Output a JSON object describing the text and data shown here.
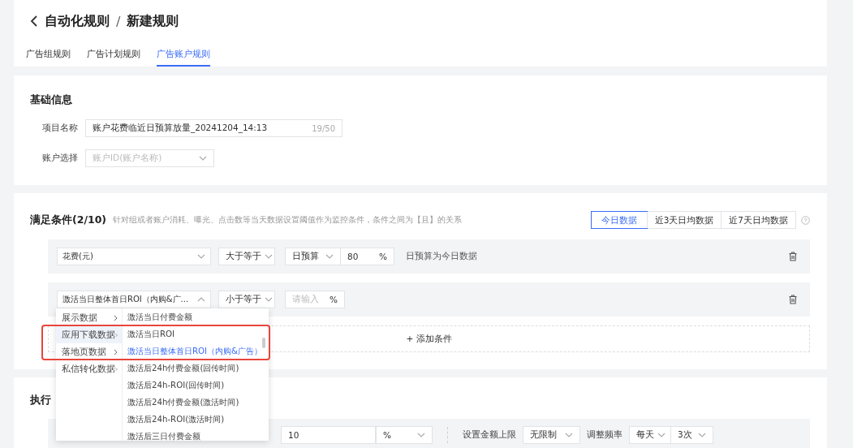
{
  "header": {
    "title": "自动化规则",
    "separator": "/",
    "subtitle": "新建规则"
  },
  "tabs": [
    {
      "label": "广告组规则",
      "selected": false
    },
    {
      "label": "广告计划规则",
      "selected": false
    },
    {
      "label": "广告账户规则",
      "selected": true
    }
  ],
  "basic_info": {
    "title": "基础信息",
    "fields": [
      {
        "kind": "text",
        "label": "项目名称",
        "value": "账户花费临近日预算放量_20241204_14:13",
        "counter": "19/50"
      },
      {
        "kind": "select",
        "label": "账户选择",
        "placeholder": "账户ID(账户名称)"
      }
    ]
  },
  "conditions": {
    "title": "满足条件(2/10)",
    "hint": "针对组或者账户消耗、曝光、点击数等当天数据设置阈值作为监控条件，条件之间为【且】的关系",
    "range_tabs": [
      {
        "label": "今日数据",
        "selected": true
      },
      {
        "label": "近3天日均数据",
        "selected": false
      },
      {
        "label": "近7天日均数据",
        "selected": false
      }
    ],
    "rows": [
      {
        "metric": "花费(元)",
        "metric_open": false,
        "operator": "大于等于",
        "base": "日预算",
        "value": "80",
        "unit": "%",
        "note": "日预算为今日数据"
      },
      {
        "metric": "激活当日整体首日ROI（内购&广...",
        "metric_open": true,
        "operator": "小于等于",
        "value_placeholder": "请输入",
        "unit": "%"
      }
    ],
    "add_label": "+ 添加条件"
  },
  "actions": {
    "title": "执行",
    "row": {
      "value": "10",
      "unit": "%",
      "cap_label": "设置金额上限",
      "cap": "无限制",
      "freq_label": "调整频率",
      "freq_period": "每天",
      "freq_count": "3次"
    }
  },
  "dropdown": {
    "highlighted": true,
    "categories": [
      {
        "label": "展示数据",
        "selected": false
      },
      {
        "label": "应用下载数据",
        "selected": true
      },
      {
        "label": "落地页数据",
        "selected": false
      },
      {
        "label": "私信转化数据",
        "selected": false
      }
    ],
    "options": [
      {
        "label": "激活当日付费金额",
        "selected": false
      },
      {
        "label": "激活当日ROI",
        "selected": false
      },
      {
        "label": "激活当日整体首日ROI（内购&广告）",
        "selected": true
      },
      {
        "label": "激活后24h付费金额(回传时间)",
        "selected": false
      },
      {
        "label": "激活后24h-ROI(回传时间)",
        "selected": false
      },
      {
        "label": "激活后24h付费金额(激活时间)",
        "selected": false
      },
      {
        "label": "激活后24h-ROI(激活时间)",
        "selected": false
      },
      {
        "label": "激活后三日付费金额",
        "selected": false
      }
    ]
  }
}
